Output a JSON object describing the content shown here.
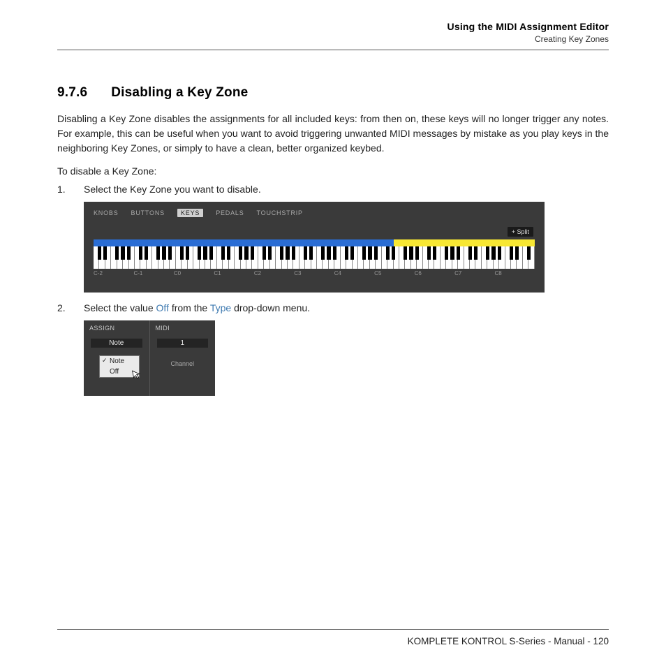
{
  "header": {
    "title": "Using the MIDI Assignment Editor",
    "subtitle": "Creating Key Zones"
  },
  "section": {
    "number": "9.7.6",
    "title": "Disabling a Key Zone"
  },
  "paragraph": "Disabling a Key Zone disables the assignments for all included keys: from then on, these keys will no longer trigger any notes. For example, this can be useful when you want to avoid triggering unwanted MIDI messages by mistake as you play keys in the neighboring Key Zones, or simply to have a clean, better organized keybed.",
  "intro": "To disable a Key Zone:",
  "step1": {
    "num": "1.",
    "text": "Select the Key Zone you want to disable."
  },
  "step2": {
    "num": "2.",
    "pre": "Select the value ",
    "off": "Off",
    "mid": " from the ",
    "type": "Type",
    "post": " drop-down menu."
  },
  "editor": {
    "tabs": {
      "t0": "KNOBS",
      "t1": "BUTTONS",
      "t2": "KEYS",
      "t3": "PEDALS",
      "t4": "TOUCHSTRIP"
    },
    "split": "+ Split",
    "oct": {
      "o0": "C-2",
      "o1": "C-1",
      "o2": "C0",
      "o3": "C1",
      "o4": "C2",
      "o5": "C3",
      "o6": "C4",
      "o7": "C5",
      "o8": "C6",
      "o9": "C7",
      "o10": "C8"
    }
  },
  "panel": {
    "col1": "ASSIGN",
    "col2": "MIDI",
    "val1": "Note",
    "val2": "1",
    "sub2": "Channel",
    "opt1": "Note",
    "opt2": "Off"
  },
  "footer": {
    "text": "KOMPLETE KONTROL S-Series - Manual - 120"
  }
}
